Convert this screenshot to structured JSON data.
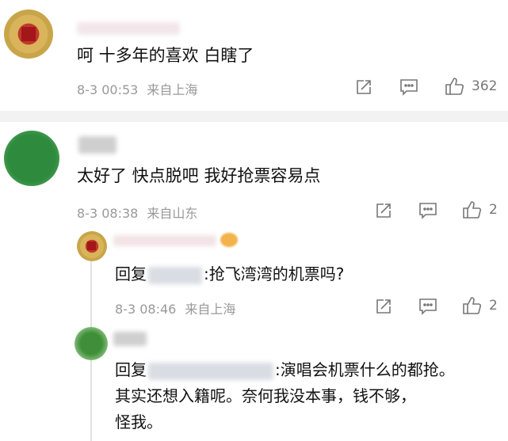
{
  "comments": [
    {
      "text": "呵 十多年的喜欢 白瞎了",
      "time": "8-3 00:53",
      "location": "来自上海",
      "like_count": "362",
      "avatar_color": "#c9a54a"
    },
    {
      "text": "太好了 快点脱吧 我好抢票容易点",
      "time": "8-3 08:38",
      "location": "来自山东",
      "like_count": "2",
      "avatar_color": "#1f7f36"
    }
  ],
  "replies": [
    {
      "prefix": "回复",
      "text": ":抢飞湾湾的机票吗?",
      "time": "8-3 08:46",
      "location": "来自上海",
      "like_count": "2",
      "avatar_color": "#c9a54a"
    },
    {
      "prefix": "回复",
      "text": ":演唱会机票什么的都抢。",
      "line2": "其实还想入籍呢。奈何我没本事，钱不够，",
      "line3": "怪我。",
      "avatar_color": "#3f8f3a"
    }
  ],
  "colors": {
    "meta": "#999999",
    "text": "#111111",
    "divider": "#f2f2f2"
  },
  "icons": [
    "share-icon",
    "comment-icon",
    "like-icon"
  ]
}
